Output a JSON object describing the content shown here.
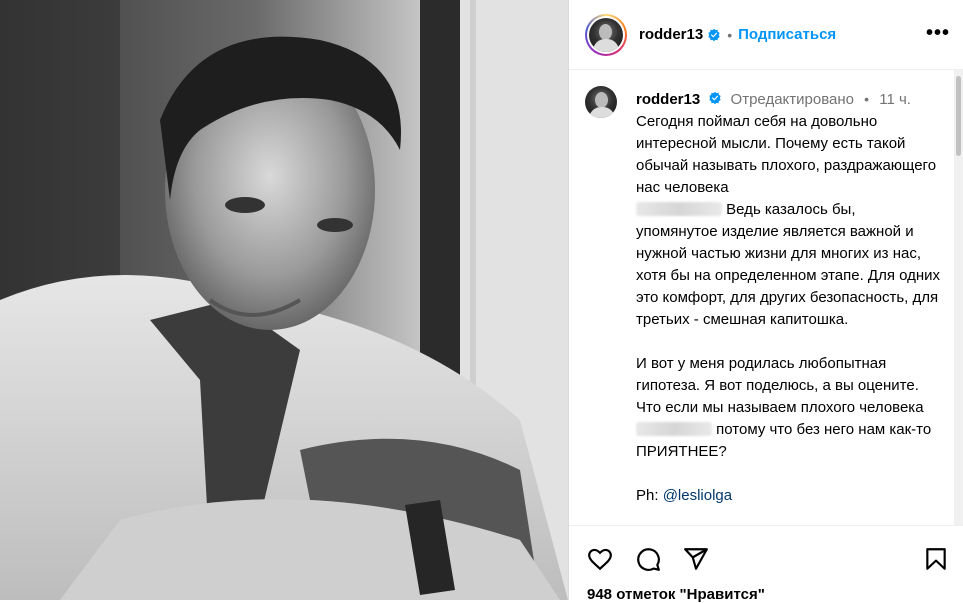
{
  "post": {
    "author": "rodder13",
    "follow_label": "Подписаться",
    "more_label": "•••"
  },
  "caption": {
    "author": "rodder13",
    "edited": "Отредактировано",
    "separator": "•",
    "time": "11 ч.",
    "line1": "Сегодня поймал себя на довольно интересной мысли. Почему есть такой обычай называть плохого, раздражающего нас человека",
    "line2": " Ведь казалось бы, упомянутое изделие является важной и нужной частью жизни для многих из нас, хотя бы на определенном этапе. Для одних это комфорт, для других безопасность, для третьих - смешная капитошка.",
    "line3": "И вот у меня родилась любопытная гипотеза. Я вот поделюсь, а вы оцените. Что если мы называем плохого человека",
    "line4": " потому что без него нам как-то ПРИЯТНЕЕ?",
    "credit_prefix": "Ph: ",
    "credit_mention": "@lesliolga"
  },
  "likes": "948 отметок \"Нравится\"",
  "icons": [
    "heart-icon",
    "comment-icon",
    "share-icon",
    "bookmark-icon",
    "verified-icon",
    "more-icon"
  ],
  "colors": {
    "accent": "#0095f6",
    "mention": "#00376b",
    "muted": "#737373"
  }
}
